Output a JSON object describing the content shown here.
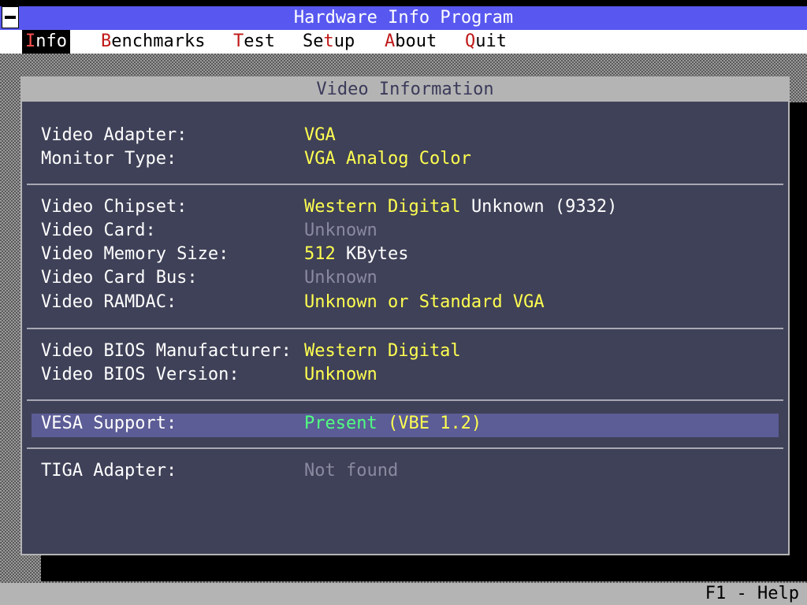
{
  "app": {
    "title": "Hardware Info Program"
  },
  "menu": [
    {
      "hotkey": "I",
      "rest": "nfo",
      "active": true
    },
    {
      "hotkey": "B",
      "rest": "enchmarks"
    },
    {
      "hotkey": "T",
      "rest": "est"
    },
    {
      "pre": "Se",
      "hotkey": "t",
      "rest": "up"
    },
    {
      "hotkey": "A",
      "rest": "bout"
    },
    {
      "hotkey": "Q",
      "rest": "uit"
    }
  ],
  "window": {
    "title": "Video Information",
    "rows": {
      "adapter": {
        "label": "Video Adapter:",
        "value": "VGA"
      },
      "monitor": {
        "label": "Monitor Type:",
        "value": "VGA Analog Color"
      },
      "chipset": {
        "label": "Video Chipset:",
        "value_a": "Western Digital",
        "value_b": "Unknown (9332)"
      },
      "card": {
        "label": "Video Card:",
        "value": "Unknown"
      },
      "memory": {
        "label": "Video Memory Size:",
        "value_a": "512",
        "value_b": "KBytes"
      },
      "bus": {
        "label": "Video Card Bus:",
        "value": "Unknown"
      },
      "ramdac": {
        "label": "Video RAMDAC:",
        "value": "Unknown or Standard VGA"
      },
      "bios_mfr": {
        "label": "Video BIOS Manufacturer:",
        "value": "Western Digital"
      },
      "bios_ver": {
        "label": "Video BIOS Version:",
        "value": "Unknown"
      },
      "vesa": {
        "label": "VESA Support:",
        "value_a": "Present",
        "value_b": "(VBE 1.2)"
      },
      "tiga": {
        "label": "TIGA Adapter:",
        "value": "Not found"
      }
    }
  },
  "status": {
    "help": "F1 - Help"
  }
}
